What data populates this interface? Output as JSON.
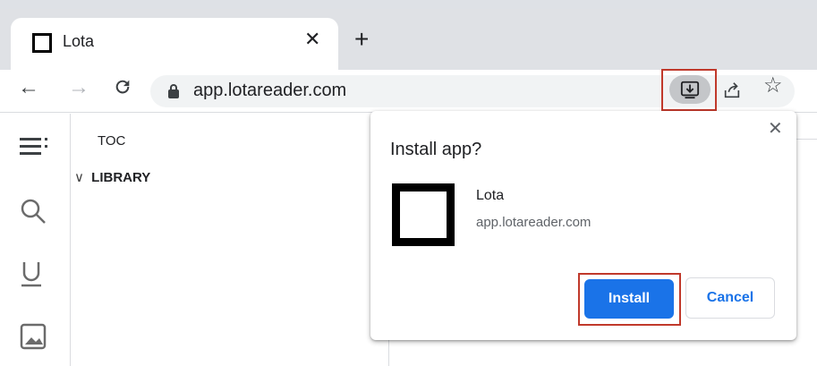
{
  "tab": {
    "title": "Lota",
    "close_glyph": "✕",
    "new_tab_glyph": "+"
  },
  "toolbar": {
    "back_glyph": "←",
    "forward_glyph": "→",
    "reload_glyph": "C",
    "url": "app.lotareader.com",
    "star_glyph": "☆"
  },
  "sidebar": {
    "toc_label": "TOC",
    "library_chevron": "∨",
    "library_label": "LIBRARY"
  },
  "install_dialog": {
    "title": "Install app?",
    "close_glyph": "✕",
    "app_name": "Lota",
    "app_url": "app.lotareader.com",
    "install_label": "Install",
    "cancel_label": "Cancel"
  },
  "colors": {
    "accent": "#1a73e8",
    "highlight_box": "#c0392b",
    "tabstrip_bg": "#dfe1e5"
  },
  "icons": [
    "tab-favicon",
    "back-arrow-icon",
    "forward-arrow-icon",
    "reload-icon",
    "lock-icon",
    "install-app-icon",
    "share-icon",
    "star-icon",
    "menu-icon",
    "search-icon",
    "underline-icon",
    "image-icon",
    "app-icon"
  ]
}
